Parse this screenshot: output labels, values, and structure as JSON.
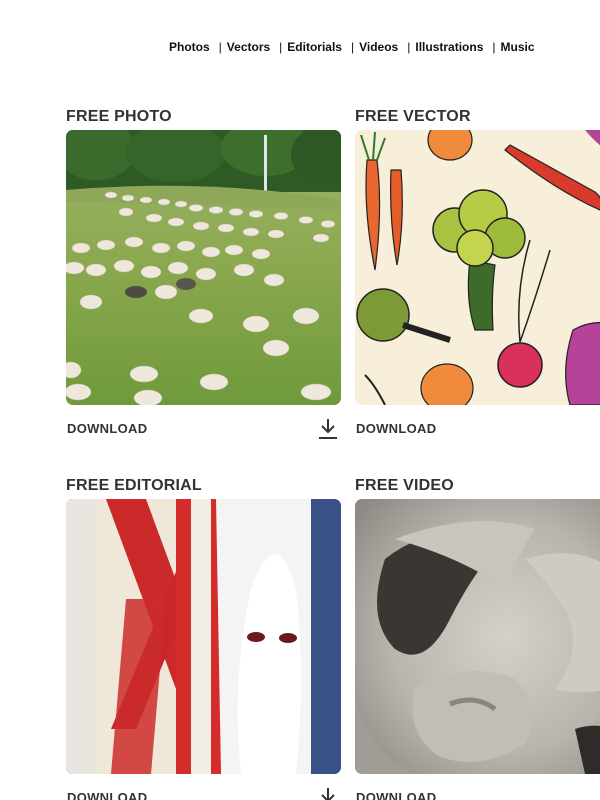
{
  "nav": {
    "items": [
      "Photos",
      "Vectors",
      "Editorials",
      "Videos",
      "Illustrations",
      "Music"
    ],
    "separator": "|"
  },
  "cards": [
    {
      "title": "FREE PHOTO",
      "download_label": "DOWNLOAD",
      "image": "sheep-in-meadow"
    },
    {
      "title": "FREE VECTOR",
      "download_label": "DOWNLOAD",
      "image": "vegetables-illustration"
    },
    {
      "title": "FREE EDITORIAL",
      "download_label": "DOWNLOAD",
      "image": "flags-and-hooded-robe"
    },
    {
      "title": "FREE VIDEO",
      "download_label": "DOWNLOAD",
      "image": "stone-sculpture-closeup"
    }
  ],
  "icons": {
    "download": "download-icon"
  }
}
